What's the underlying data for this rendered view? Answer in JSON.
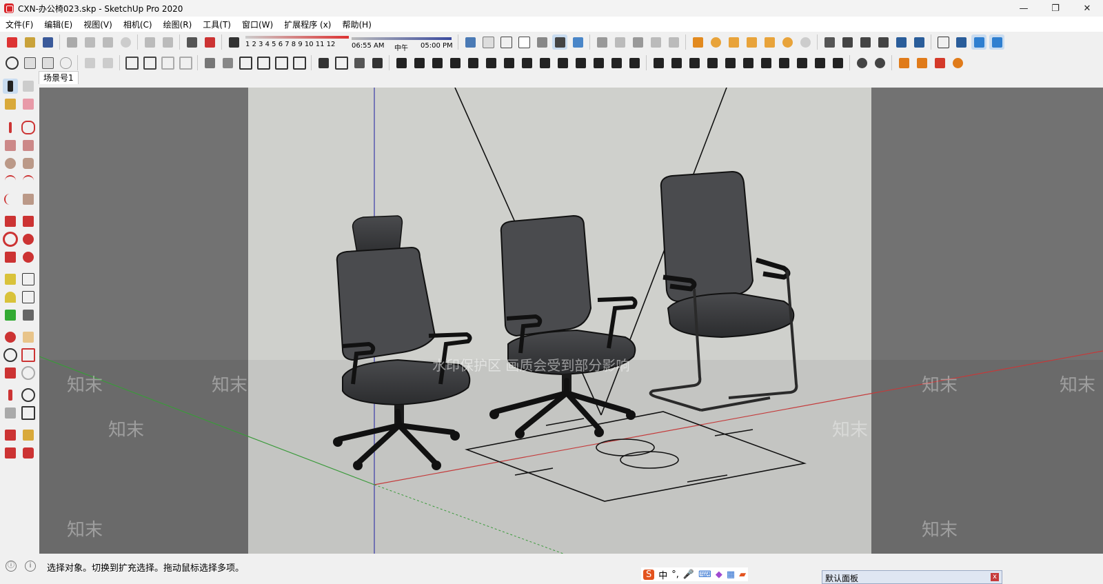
{
  "window": {
    "title": "CXN-办公椅023.skp - SketchUp Pro 2020",
    "minimize": "—",
    "restore": "❐",
    "close": "✕"
  },
  "menu": [
    "文件(F)",
    "编辑(E)",
    "视图(V)",
    "相机(C)",
    "绘图(R)",
    "工具(T)",
    "窗口(W)",
    "扩展程序 (x)",
    "帮助(H)"
  ],
  "shadow": {
    "months": "1 2 3 4 5 6 7 8 9 10 11 12",
    "time_start": "06:55 AM",
    "time_mid": "中午",
    "time_end": "05:00 PM"
  },
  "scene_tab": "场景号1",
  "viewport": {
    "watermark_notice": "水印保护区 画质会受到部分影响",
    "watermark_brand": "知末"
  },
  "status": {
    "message": "选择对象。切换到扩充选择。拖动鼠标选择多项。"
  },
  "ime": {
    "logo": "S",
    "mode": "中",
    "punct": "°,"
  },
  "tray_panel": {
    "title": "默认面板",
    "close": "x"
  },
  "colors": {
    "background_gray": "#727272",
    "sky": "#cfd0cc",
    "ground": "#c4c5c2",
    "chair": "#3a3b3d",
    "red_axis": "#c43a3a",
    "green_axis": "#3a9a3a",
    "blue_axis": "#3a3aa8"
  }
}
